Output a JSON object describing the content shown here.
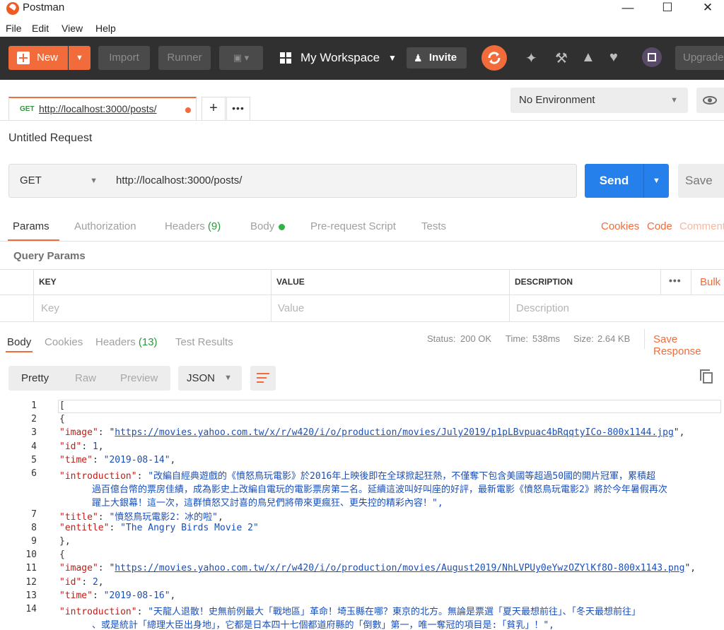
{
  "window": {
    "title": "Postman"
  },
  "menu": [
    "File",
    "Edit",
    "View",
    "Help"
  ],
  "toolbar": {
    "new_label": "New",
    "import_label": "Import",
    "runner_label": "Runner",
    "workspace_label": "My Workspace",
    "invite_label": "Invite",
    "upgrade_label": "Upgrade"
  },
  "request_tab": {
    "method": "GET",
    "url": "http://localhost:3000/posts/"
  },
  "environment": {
    "selected": "No Environment"
  },
  "request": {
    "name": "Untitled Request",
    "method": "GET",
    "url": "http://localhost:3000/posts/",
    "send_label": "Send",
    "save_label": "Save"
  },
  "request_tabs": {
    "params": "Params",
    "authorization": "Authorization",
    "headers": "Headers",
    "headers_count": "(9)",
    "body": "Body",
    "prerequest": "Pre-request Script",
    "tests": "Tests",
    "cookies": "Cookies",
    "code": "Code",
    "comments": "Comments"
  },
  "query_params": {
    "title": "Query Params",
    "columns": [
      "KEY",
      "VALUE",
      "DESCRIPTION"
    ],
    "bulk_label": "Bulk",
    "placeholders": [
      "Key",
      "Value",
      "Description"
    ]
  },
  "response_tabs": {
    "body": "Body",
    "cookies": "Cookies",
    "headers": "Headers",
    "headers_count": "(13)",
    "test_results": "Test Results"
  },
  "response_status": {
    "status_label": "Status:",
    "status_value": "200 OK",
    "time_label": "Time:",
    "time_value": "538ms",
    "size_label": "Size:",
    "size_value": "2.64 KB",
    "save_response": "Save Response"
  },
  "view": {
    "pretty": "Pretty",
    "raw": "Raw",
    "preview": "Preview",
    "format": "JSON"
  },
  "code_lines": [
    {
      "n": "1",
      "t": "["
    },
    {
      "n": "2",
      "t": "  {"
    },
    {
      "n": "3",
      "key": "image",
      "url": "https://movies.yahoo.com.tw/x/r/w420/i/o/production/movies/July2019/p1pLBvpuac4bRqqtyICo-800x1144.jpg",
      "tail": ","
    },
    {
      "n": "4",
      "key": "id",
      "num": "1",
      "tail": ","
    },
    {
      "n": "5",
      "key": "time",
      "str": "\"2019-08-14\"",
      "tail": ","
    },
    {
      "n": "6",
      "key": "introduction",
      "str": "\"改編自經典遊戲的《憤怒鳥玩電影》於2016年上映後即在全球掀起狂熱，不僅奪下包含美國等超過50國的開片冠軍，累積超"
    },
    {
      "n": "",
      "cont": "過百億台幣的票房佳績，成為影史上改編自電玩的電影票房第二名。延續這波叫好叫座的好評，最新電影《憤怒鳥玩電影2》將於今年暑假再次"
    },
    {
      "n": "",
      "cont": "躍上大銀幕！這一次，這群憤怒又討喜的鳥兒們將帶來更瘋狂、更失控的精彩內容！\",",
      "indent": 1
    },
    {
      "n": "7",
      "key": "title",
      "str": "\"憤怒鳥玩電影2：冰的啦\"",
      "tail": ","
    },
    {
      "n": "8",
      "key": "entitle",
      "str": "\"The Angry Birds Movie 2\""
    },
    {
      "n": "9",
      "t": "  },"
    },
    {
      "n": "10",
      "t": "  {"
    },
    {
      "n": "11",
      "key": "image",
      "url": "https://movies.yahoo.com.tw/x/r/w420/i/o/production/movies/August2019/NhLVPUy0eYwzOZYlKf8O-800x1143.png",
      "tail": ","
    },
    {
      "n": "12",
      "key": "id",
      "num": "2",
      "tail": ","
    },
    {
      "n": "13",
      "key": "time",
      "str": "\"2019-08-16\"",
      "tail": ","
    },
    {
      "n": "14",
      "key": "introduction",
      "str": "\"天龍人退散！史無前例最大「戰地區」革命！埼玉縣在哪？東京的北方。無論是票選「夏天最想前往」、「冬天最想前往」"
    },
    {
      "n": "",
      "cont": "、或是統計「總理大臣出身地」，它都是日本四十七個都道府縣的「倒數」第一，唯一奪冠的項目是:「貧乳」！\","
    }
  ]
}
